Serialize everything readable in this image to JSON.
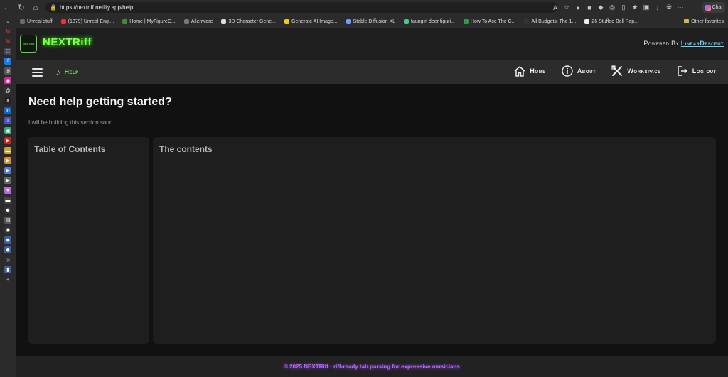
{
  "browser": {
    "url": "https://nextriff.netlify.app/help",
    "copilot_label": "Chat",
    "favorites": [
      {
        "label": "Unreal stuff",
        "color": "#6a6a6a"
      },
      {
        "label": "(1379) Unreal Engi...",
        "color": "#e33"
      },
      {
        "label": "Home | MyFigureC...",
        "color": "#3a8f3a"
      },
      {
        "label": "Alienware",
        "color": "#777"
      },
      {
        "label": "3D Character Gene...",
        "color": "#ddd"
      },
      {
        "label": "Generate AI Image...",
        "color": "#f5c518"
      },
      {
        "label": "Stable Diffusion XL",
        "color": "#6aa0ff"
      },
      {
        "label": "faungirl deer figuri...",
        "color": "#4c8"
      },
      {
        "label": "How To Ace The C...",
        "color": "#2a9d4a"
      },
      {
        "label": "All Budgets: The 1...",
        "color": "#333"
      },
      {
        "label": "26 Stuffed Bell Pep...",
        "color": "#eee"
      }
    ],
    "other_favorites": "Other favorites"
  },
  "app": {
    "brand": "NEXTRiff",
    "logo_text": "NEXTRiff",
    "powered_prefix": "Powered By",
    "powered_link": "LinearDescent",
    "nav": {
      "current": "Help",
      "links": [
        "Home",
        "About",
        "Workspace",
        "Log out"
      ]
    },
    "page": {
      "title": "Need help getting started?",
      "subtitle": "I will be building this section soon.",
      "toc_heading": "Table of Contents",
      "contents_heading": "The contents"
    },
    "footer": "© 2025 NEXTRiff · riff-ready tab parsing for expressive musicians"
  },
  "colors": {
    "brand_green": "#7cff52",
    "link_blue": "#6fd0f0",
    "footer_purple": "#b66bff"
  }
}
